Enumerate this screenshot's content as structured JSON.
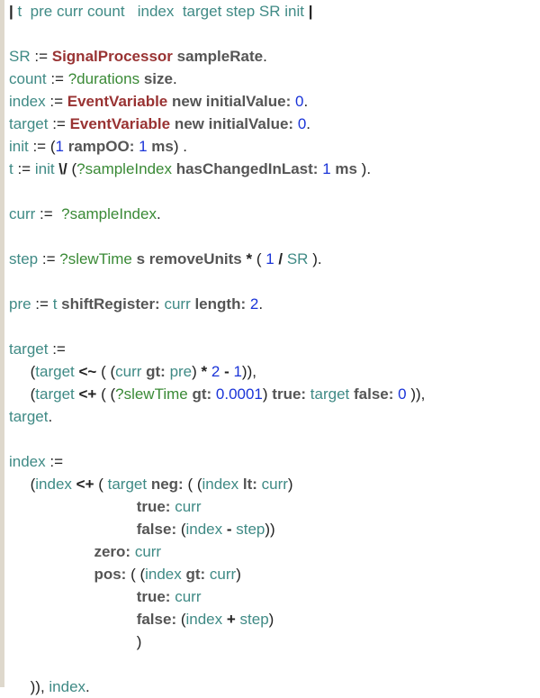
{
  "editor": {
    "name": "smalltalk-code-editor",
    "background_color": "#ffffff",
    "gutter_color": "#ded8cc",
    "font_size_px": 17,
    "line_height_px": 25,
    "colors": {
      "variable": "#3f8a85",
      "class": "#993333",
      "keyword_message": "#555555",
      "number": "#1a34d8",
      "dynamic_binding": "#3a8a36",
      "punctuation": "#222222"
    }
  },
  "code": {
    "language": "Smalltalk",
    "temporaries": [
      "t",
      "pre",
      "curr",
      "count",
      "index",
      "target",
      "step",
      "SR",
      "init"
    ],
    "lines": [
      {
        "id": "line-1-temps",
        "text": "| t  pre curr count   index  target step SR init |",
        "tokens": [
          {
            "t": "|",
            "c": "bar"
          },
          {
            "t": " t  ",
            "c": "var"
          },
          {
            "t": "pre curr count",
            "c": "var"
          },
          {
            "t": "   ",
            "c": "plain"
          },
          {
            "t": "index",
            "c": "var"
          },
          {
            "t": "  ",
            "c": "plain"
          },
          {
            "t": "target step SR init",
            "c": "var"
          },
          {
            "t": " ",
            "c": "plain"
          },
          {
            "t": "|",
            "c": "bar"
          }
        ]
      },
      {
        "id": "line-2-blank",
        "text": "",
        "tokens": []
      },
      {
        "id": "line-3-sr",
        "text": "SR := SignalProcessor sampleRate.",
        "tokens": [
          {
            "t": "SR",
            "c": "var"
          },
          {
            "t": " := ",
            "c": "punct"
          },
          {
            "t": "SignalProcessor",
            "c": "cls"
          },
          {
            "t": " sampleRate",
            "c": "kw"
          },
          {
            "t": ".",
            "c": "punct"
          }
        ]
      },
      {
        "id": "line-4-count",
        "text": "count := ?durations size.",
        "tokens": [
          {
            "t": "count",
            "c": "var"
          },
          {
            "t": " := ",
            "c": "punct"
          },
          {
            "t": "?durations",
            "c": "dyn"
          },
          {
            "t": " size",
            "c": "kw"
          },
          {
            "t": ".",
            "c": "punct"
          }
        ]
      },
      {
        "id": "line-5-index",
        "text": "index := EventVariable new initialValue: 0.",
        "tokens": [
          {
            "t": "index",
            "c": "var"
          },
          {
            "t": " := ",
            "c": "punct"
          },
          {
            "t": "EventVariable",
            "c": "cls"
          },
          {
            "t": " new initialValue: ",
            "c": "kw"
          },
          {
            "t": "0",
            "c": "num"
          },
          {
            "t": ".",
            "c": "punct"
          }
        ]
      },
      {
        "id": "line-6-target",
        "text": "target := EventVariable new initialValue: 0.",
        "tokens": [
          {
            "t": "target",
            "c": "var"
          },
          {
            "t": " := ",
            "c": "punct"
          },
          {
            "t": "EventVariable",
            "c": "cls"
          },
          {
            "t": " new initialValue: ",
            "c": "kw"
          },
          {
            "t": "0",
            "c": "num"
          },
          {
            "t": ".",
            "c": "punct"
          }
        ]
      },
      {
        "id": "line-7-init",
        "text": "init := (1 rampOO: 1 ms) .",
        "tokens": [
          {
            "t": "init",
            "c": "var"
          },
          {
            "t": " := ",
            "c": "punct"
          },
          {
            "t": "(",
            "c": "punct"
          },
          {
            "t": "1",
            "c": "num"
          },
          {
            "t": " rampOO: ",
            "c": "kw"
          },
          {
            "t": "1",
            "c": "num"
          },
          {
            "t": " ms",
            "c": "kw"
          },
          {
            "t": ") .",
            "c": "punct"
          }
        ]
      },
      {
        "id": "line-8-t",
        "text": "t := init \\/ (?sampleIndex hasChangedInLast: 1 ms ).",
        "tokens": [
          {
            "t": "t",
            "c": "var"
          },
          {
            "t": " := ",
            "c": "punct"
          },
          {
            "t": "init",
            "c": "var"
          },
          {
            "t": " \\/ ",
            "c": "op"
          },
          {
            "t": "(",
            "c": "punct"
          },
          {
            "t": "?sampleIndex",
            "c": "dyn"
          },
          {
            "t": " hasChangedInLast: ",
            "c": "kw"
          },
          {
            "t": "1",
            "c": "num"
          },
          {
            "t": " ms",
            "c": "kw"
          },
          {
            "t": " ).",
            "c": "punct"
          }
        ]
      },
      {
        "id": "line-9-blank",
        "text": "",
        "tokens": []
      },
      {
        "id": "line-10-curr",
        "text": "curr :=  ?sampleIndex.",
        "tokens": [
          {
            "t": "curr",
            "c": "var"
          },
          {
            "t": " :=  ",
            "c": "punct"
          },
          {
            "t": "?sampleIndex",
            "c": "dyn"
          },
          {
            "t": ".",
            "c": "punct"
          }
        ]
      },
      {
        "id": "line-11-blank",
        "text": "",
        "tokens": []
      },
      {
        "id": "line-12-step",
        "text": "step := ?slewTime s removeUnits * ( 1 / SR ).",
        "tokens": [
          {
            "t": "step",
            "c": "var"
          },
          {
            "t": " := ",
            "c": "punct"
          },
          {
            "t": "?slewTime",
            "c": "dyn"
          },
          {
            "t": " s removeUnits",
            "c": "kw"
          },
          {
            "t": " * ",
            "c": "op"
          },
          {
            "t": "( ",
            "c": "punct"
          },
          {
            "t": "1",
            "c": "num"
          },
          {
            "t": " / ",
            "c": "op"
          },
          {
            "t": "SR",
            "c": "var"
          },
          {
            "t": " ).",
            "c": "punct"
          }
        ]
      },
      {
        "id": "line-13-blank",
        "text": "",
        "tokens": []
      },
      {
        "id": "line-14-pre",
        "text": "pre := t shiftRegister: curr length: 2.",
        "tokens": [
          {
            "t": "pre",
            "c": "var"
          },
          {
            "t": " := ",
            "c": "punct"
          },
          {
            "t": "t",
            "c": "var"
          },
          {
            "t": " shiftRegister: ",
            "c": "kw"
          },
          {
            "t": "curr",
            "c": "var"
          },
          {
            "t": " length: ",
            "c": "kw"
          },
          {
            "t": "2",
            "c": "num"
          },
          {
            "t": ".",
            "c": "punct"
          }
        ]
      },
      {
        "id": "line-15-blank",
        "text": "",
        "tokens": []
      },
      {
        "id": "line-16-target-assign",
        "text": "target :=",
        "tokens": [
          {
            "t": "target",
            "c": "var"
          },
          {
            "t": " :=",
            "c": "punct"
          }
        ]
      },
      {
        "id": "line-17-target-tilde",
        "text": "     (target <~ ( (curr gt: pre) * 2 - 1)),",
        "tokens": [
          {
            "t": "     (",
            "c": "punct"
          },
          {
            "t": "target",
            "c": "var"
          },
          {
            "t": " <~ ",
            "c": "op"
          },
          {
            "t": "( (",
            "c": "punct"
          },
          {
            "t": "curr",
            "c": "var"
          },
          {
            "t": " gt: ",
            "c": "kw"
          },
          {
            "t": "pre",
            "c": "var"
          },
          {
            "t": ")",
            "c": "punct"
          },
          {
            "t": " * ",
            "c": "op"
          },
          {
            "t": "2",
            "c": "num"
          },
          {
            "t": " - ",
            "c": "op"
          },
          {
            "t": "1",
            "c": "num"
          },
          {
            "t": ")),",
            "c": "punct"
          }
        ]
      },
      {
        "id": "line-18-target-plus",
        "text": "     (target <+ ( (?slewTime gt: 0.0001) true: target false: 0 )),",
        "tokens": [
          {
            "t": "     (",
            "c": "punct"
          },
          {
            "t": "target",
            "c": "var"
          },
          {
            "t": " <+ ",
            "c": "op"
          },
          {
            "t": "( (",
            "c": "punct"
          },
          {
            "t": "?slewTime",
            "c": "dyn"
          },
          {
            "t": " gt: ",
            "c": "kw"
          },
          {
            "t": "0.0001",
            "c": "num"
          },
          {
            "t": ")",
            "c": "punct"
          },
          {
            "t": " true: ",
            "c": "kw"
          },
          {
            "t": "target",
            "c": "var"
          },
          {
            "t": " false: ",
            "c": "kw"
          },
          {
            "t": "0",
            "c": "num"
          },
          {
            "t": " )),",
            "c": "punct"
          }
        ]
      },
      {
        "id": "line-19-target-end",
        "text": "target.",
        "tokens": [
          {
            "t": "target",
            "c": "var"
          },
          {
            "t": ".",
            "c": "punct"
          }
        ]
      },
      {
        "id": "line-20-blank",
        "text": "",
        "tokens": []
      },
      {
        "id": "line-21-index-assign",
        "text": "index :=",
        "tokens": [
          {
            "t": "index",
            "c": "var"
          },
          {
            "t": " :=",
            "c": "punct"
          }
        ]
      },
      {
        "id": "line-22-index-plus",
        "text": "     (index <+ ( target neg: ( (index lt: curr)",
        "tokens": [
          {
            "t": "     (",
            "c": "punct"
          },
          {
            "t": "index",
            "c": "var"
          },
          {
            "t": " <+ ",
            "c": "op"
          },
          {
            "t": "( ",
            "c": "punct"
          },
          {
            "t": "target",
            "c": "var"
          },
          {
            "t": " neg: ",
            "c": "kw"
          },
          {
            "t": "( (",
            "c": "punct"
          },
          {
            "t": "index",
            "c": "var"
          },
          {
            "t": " lt: ",
            "c": "kw"
          },
          {
            "t": "curr",
            "c": "var"
          },
          {
            "t": ")",
            "c": "punct"
          }
        ]
      },
      {
        "id": "line-23-neg-true",
        "text": "                              true: curr",
        "tokens": [
          {
            "t": "                              true: ",
            "c": "kw"
          },
          {
            "t": "curr",
            "c": "var"
          }
        ]
      },
      {
        "id": "line-24-neg-false",
        "text": "                              false: (index - step))",
        "tokens": [
          {
            "t": "                              false: ",
            "c": "kw"
          },
          {
            "t": "(",
            "c": "punct"
          },
          {
            "t": "index",
            "c": "var"
          },
          {
            "t": " - ",
            "c": "op"
          },
          {
            "t": "step",
            "c": "var"
          },
          {
            "t": "))",
            "c": "punct"
          }
        ]
      },
      {
        "id": "line-25-zero",
        "text": "                    zero: curr",
        "tokens": [
          {
            "t": "                    zero: ",
            "c": "kw"
          },
          {
            "t": "curr",
            "c": "var"
          }
        ]
      },
      {
        "id": "line-26-pos",
        "text": "                    pos: ( (index gt: curr)",
        "tokens": [
          {
            "t": "                    pos: ",
            "c": "kw"
          },
          {
            "t": "( (",
            "c": "punct"
          },
          {
            "t": "index",
            "c": "var"
          },
          {
            "t": " gt: ",
            "c": "kw"
          },
          {
            "t": "curr",
            "c": "var"
          },
          {
            "t": ")",
            "c": "punct"
          }
        ]
      },
      {
        "id": "line-27-pos-true",
        "text": "                              true: curr",
        "tokens": [
          {
            "t": "                              true: ",
            "c": "kw"
          },
          {
            "t": "curr",
            "c": "var"
          }
        ]
      },
      {
        "id": "line-28-pos-false",
        "text": "                              false: (index + step)",
        "tokens": [
          {
            "t": "                              false: ",
            "c": "kw"
          },
          {
            "t": "(",
            "c": "punct"
          },
          {
            "t": "index",
            "c": "var"
          },
          {
            "t": " + ",
            "c": "op"
          },
          {
            "t": "step",
            "c": "var"
          },
          {
            "t": ")",
            "c": "punct"
          }
        ]
      },
      {
        "id": "line-29-close-paren",
        "text": "                              )",
        "tokens": [
          {
            "t": "                              )",
            "c": "punct"
          }
        ]
      },
      {
        "id": "line-30-blank",
        "text": "",
        "tokens": []
      },
      {
        "id": "line-31-index-end",
        "text": "     )), index.",
        "tokens": [
          {
            "t": "     )), ",
            "c": "punct"
          },
          {
            "t": "index",
            "c": "var"
          },
          {
            "t": ".",
            "c": "punct"
          }
        ]
      }
    ]
  }
}
